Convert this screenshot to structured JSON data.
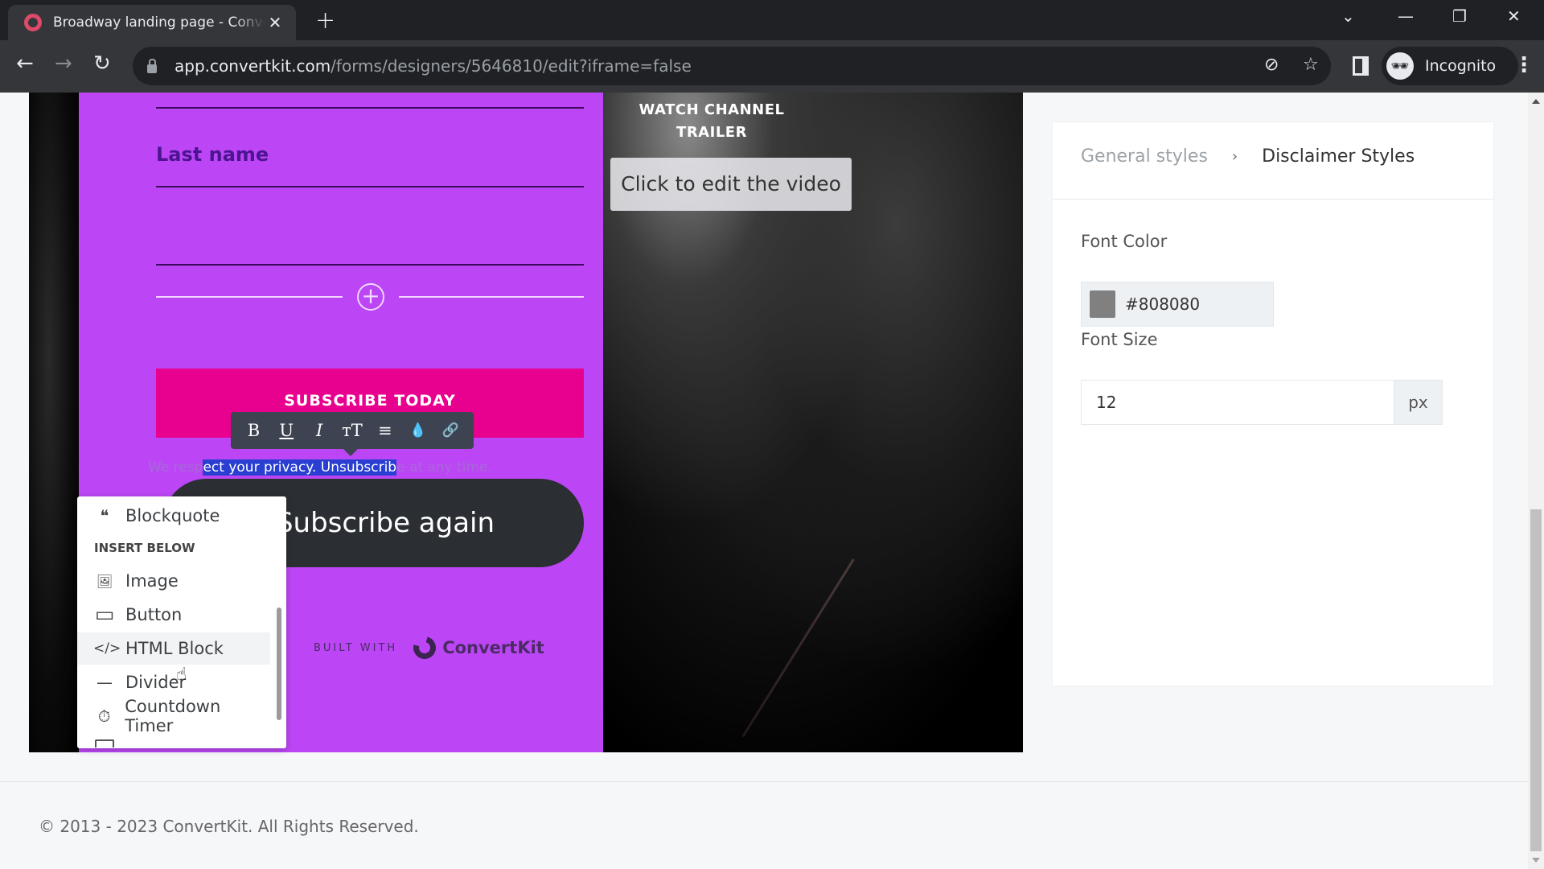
{
  "browser": {
    "tab_title": "Broadway landing page - ConvertKit",
    "tab_close": "✕",
    "new_tab": "+",
    "url_host": "app.convertkit.com",
    "url_path": "/forms/designers/5646810/edit?iframe=false",
    "profile_label": "Incognito",
    "icons": {
      "back": "←",
      "forward": "→",
      "reload": "↻",
      "eye_off": "⊘",
      "star": "☆",
      "kebab": "⋮",
      "tab_search": "⌄",
      "minimize": "—",
      "restore": "❐",
      "close": "✕",
      "incognito": "🕶"
    }
  },
  "form": {
    "last_name_label": "Last name",
    "add_block_icon": "+",
    "subscribe_button": "SUBSCRIBE TODAY",
    "format_toolbar": {
      "bold": "B",
      "underline": "U",
      "italic": "I",
      "font_size": "тT",
      "align": "≡",
      "color": "💧",
      "link": "🔗"
    },
    "disclaimer": {
      "before": "We resp",
      "selected": "ect your privacy. Unsubscrib",
      "after": "e at any time."
    },
    "close_icon": "✕",
    "subscribe_again_button": "Subscribe again",
    "built_with_label": "BUILT WITH",
    "brand_name": "ConvertKit"
  },
  "insert_menu": {
    "top_item": {
      "icon": "❝",
      "label": "Blockquote"
    },
    "heading": "INSERT BELOW",
    "items": [
      {
        "icon": "🖼",
        "label": "Image"
      },
      {
        "icon": "▭",
        "label": "Button"
      },
      {
        "icon": "</>",
        "label": "HTML Block",
        "hovered": true
      },
      {
        "icon": "—",
        "label": "Divider"
      },
      {
        "icon": "⏱",
        "label": "Countdown Timer"
      }
    ]
  },
  "video": {
    "heading_line1": "WATCH CHANNEL",
    "heading_line2": "TRAILER",
    "edit_label": "Click to edit the video"
  },
  "settings_panel": {
    "breadcrumb_parent": "General styles",
    "breadcrumb_separator": "›",
    "breadcrumb_current": "Disclaimer Styles",
    "font_color_label": "Font Color",
    "font_color_value": "#808080",
    "font_size_label": "Font Size",
    "font_size_value": "12",
    "font_size_unit": "px"
  },
  "footer": {
    "copyright": "© 2013 - 2023 ConvertKit. All Rights Reserved."
  },
  "colors": {
    "form_bg": "#bc46f5",
    "subscribe_bg": "#e8008f",
    "selection": "#2a3fd1",
    "disclaimer_swatch": "#808080"
  }
}
